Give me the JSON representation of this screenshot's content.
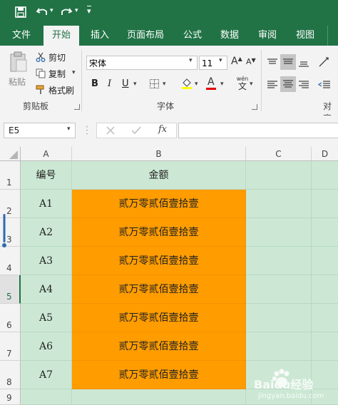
{
  "quick_access": {
    "more": "▾"
  },
  "tabs": [
    {
      "label": "文件"
    },
    {
      "label": "开始"
    },
    {
      "label": "插入"
    },
    {
      "label": "页面布局"
    },
    {
      "label": "公式"
    },
    {
      "label": "数据"
    },
    {
      "label": "审阅"
    },
    {
      "label": "视图"
    }
  ],
  "clipboard": {
    "paste_label": "粘贴",
    "cut_label": "剪切",
    "copy_label": "复制",
    "format_painter_label": "格式刷",
    "group_label": "剪贴板"
  },
  "font": {
    "name": "宋体",
    "size": "11",
    "bold": "B",
    "italic": "I",
    "underline": "U",
    "grow": "A",
    "shrink": "A",
    "font_color_letter": "A",
    "phonetic": "wén",
    "phonetic_char": "文",
    "group_label": "字体"
  },
  "alignment": {
    "group_label": "对齐"
  },
  "formula_bar": {
    "name_box": "E5",
    "fx": "fx",
    "value": ""
  },
  "grid": {
    "columns": [
      "A",
      "B",
      "C",
      "D"
    ],
    "rows": [
      "1",
      "2",
      "3",
      "4",
      "5",
      "6",
      "7",
      "8",
      "9"
    ],
    "header_row": {
      "a": "编号",
      "b": "金额"
    },
    "data_rows": [
      {
        "a": "A1",
        "b": "贰万零贰佰壹拾壹"
      },
      {
        "a": "A2",
        "b": "贰万零贰佰壹拾壹"
      },
      {
        "a": "A3",
        "b": "贰万零贰佰壹拾壹"
      },
      {
        "a": "A4",
        "b": "贰万零贰佰壹拾壹"
      },
      {
        "a": "A5",
        "b": "贰万零贰佰壹拾壹"
      },
      {
        "a": "A6",
        "b": "贰万零贰佰壹拾壹"
      },
      {
        "a": "A7",
        "b": "贰万零贰佰壹拾壹"
      }
    ]
  },
  "watermark": {
    "text": "Baidu经验",
    "subtext": "jingyan.baidu.com"
  },
  "colors": {
    "ribbon_green": "#217346",
    "cell_green": "#cce8d4",
    "highlight_orange": "#ff9c00"
  }
}
